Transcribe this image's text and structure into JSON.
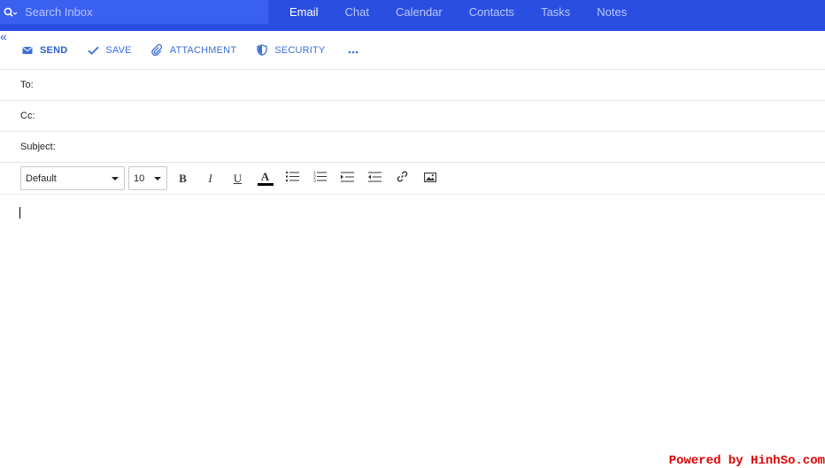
{
  "search": {
    "placeholder": "Search Inbox",
    "icon": "search-icon"
  },
  "nav": {
    "tabs": [
      {
        "label": "Email",
        "active": true
      },
      {
        "label": "Chat",
        "active": false
      },
      {
        "label": "Calendar",
        "active": false
      },
      {
        "label": "Contacts",
        "active": false
      },
      {
        "label": "Tasks",
        "active": false
      },
      {
        "label": "Notes",
        "active": false
      }
    ]
  },
  "collapse": {
    "glyph": "«",
    "icon": "double-chevron-left-icon"
  },
  "toolbar": {
    "send": {
      "label": "SEND",
      "icon": "mail-icon"
    },
    "save": {
      "label": "SAVE",
      "icon": "check-icon"
    },
    "attachment": {
      "label": "ATTACHMENT",
      "icon": "paperclip-icon"
    },
    "security": {
      "label": "SECURITY",
      "icon": "shield-icon"
    },
    "more": {
      "icon": "more-horizontal-icon"
    }
  },
  "fields": {
    "to": {
      "label": "To:",
      "value": ""
    },
    "cc": {
      "label": "Cc:",
      "value": ""
    },
    "subject": {
      "label": "Subject:",
      "value": ""
    }
  },
  "format": {
    "font": "Default",
    "size": "10",
    "bold": "B",
    "italic": "I",
    "underline": "U",
    "font_color": "A",
    "font_color_value": "#000000",
    "buttons": [
      "bold-icon",
      "italic-icon",
      "underline-icon",
      "font-color-icon",
      "bullet-list-icon",
      "numbered-list-icon",
      "indent-icon",
      "outdent-icon",
      "link-icon",
      "image-icon"
    ]
  },
  "editor": {
    "content": ""
  },
  "footer": {
    "powered": "Powered by HinhSo.com"
  },
  "colors": {
    "topbar": "#2a4fe0",
    "search_bg": "#3a60f0",
    "accent": "#3a6fd8"
  }
}
